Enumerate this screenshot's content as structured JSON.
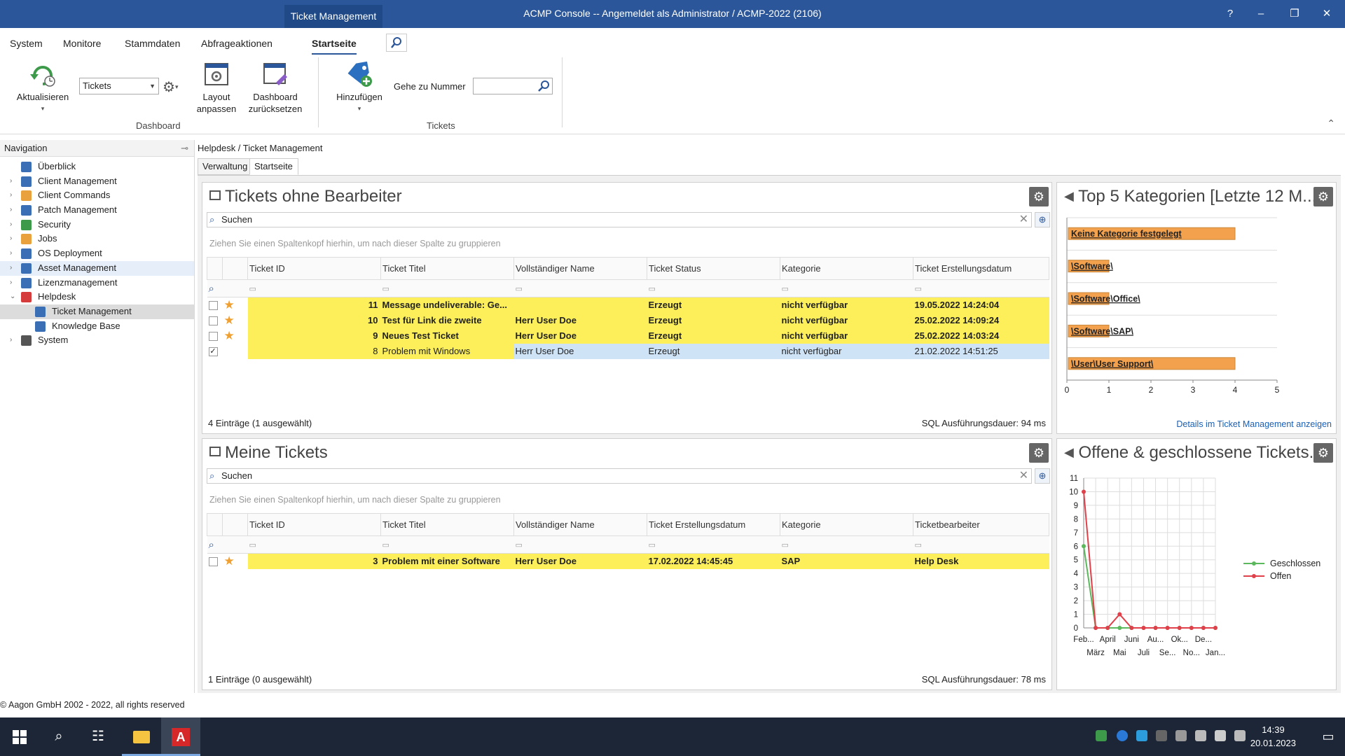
{
  "window": {
    "context_tab": "Ticket Management",
    "title": "ACMP Console -- Angemeldet als Administrator / ACMP-2022 (2106)",
    "help": "?",
    "minimize": "–",
    "restore": "❐",
    "close": "✕"
  },
  "menu": {
    "tabs": [
      "System",
      "Monitore",
      "Stammdaten",
      "Abfrageaktionen",
      "Startseite"
    ],
    "active_tab": "Startseite"
  },
  "ribbon": {
    "refresh_label": "Aktualisieren",
    "dashboard_combo": "Tickets",
    "layout_label": "Layout anpassen",
    "reset_label": "Dashboard zurücksetzen",
    "group_dashboard": "Dashboard",
    "add_label": "Hinzufügen",
    "goto_label": "Gehe zu Nummer",
    "goto_value": "",
    "group_tickets": "Tickets",
    "collapse": "⌃"
  },
  "navigation": {
    "header": "Navigation",
    "items": [
      {
        "label": "Überblick",
        "indent": 0,
        "expandable": false,
        "color": "#3a6fb5"
      },
      {
        "label": "Client Management",
        "indent": 0,
        "expandable": true,
        "color": "#3a6fb5"
      },
      {
        "label": "Client Commands",
        "indent": 0,
        "expandable": true,
        "color": "#e8a13c"
      },
      {
        "label": "Patch Management",
        "indent": 0,
        "expandable": true,
        "color": "#3a6fb5"
      },
      {
        "label": "Security",
        "indent": 0,
        "expandable": true,
        "color": "#3d9a4a"
      },
      {
        "label": "Jobs",
        "indent": 0,
        "expandable": true,
        "color": "#e8a13c"
      },
      {
        "label": "OS Deployment",
        "indent": 0,
        "expandable": true,
        "color": "#3a6fb5"
      },
      {
        "label": "Asset Management",
        "indent": 0,
        "expandable": true,
        "color": "#3a6fb5"
      },
      {
        "label": "Lizenzmanagement",
        "indent": 0,
        "expandable": true,
        "color": "#3a6fb5"
      },
      {
        "label": "Helpdesk",
        "indent": 0,
        "expandable": true,
        "expanded": true,
        "color": "#d63b3b"
      },
      {
        "label": "Ticket Management",
        "indent": 1,
        "expandable": false,
        "color": "#3a6fb5"
      },
      {
        "label": "Knowledge Base",
        "indent": 1,
        "expandable": false,
        "color": "#3a6fb5"
      },
      {
        "label": "System",
        "indent": 0,
        "expandable": true,
        "color": "#555555"
      }
    ]
  },
  "breadcrumb": "Helpdesk / Ticket Management",
  "subtabs": [
    "Verwaltung",
    "Startseite"
  ],
  "panel1": {
    "title": "Tickets ohne Bearbeiter",
    "search_placeholder": "Suchen",
    "group_hint": "Ziehen Sie einen Spaltenkopf hierhin, um nach dieser Spalte zu gruppieren",
    "columns": [
      "Ticket ID",
      "Ticket Titel",
      "Vollständiger Name",
      "Ticket Status",
      "Kategorie",
      "Ticket Erstellungsdatum"
    ],
    "rows": [
      {
        "checked": false,
        "star": true,
        "id": "11",
        "title": "Message undeliverable: Ge...",
        "name": "",
        "status": "Erzeugt",
        "category": "nicht verfügbar",
        "date": "19.05.2022 14:24:04"
      },
      {
        "checked": false,
        "star": true,
        "id": "10",
        "title": "Test für Link die zweite",
        "name": "Herr User Doe",
        "status": "Erzeugt",
        "category": "nicht verfügbar",
        "date": "25.02.2022 14:09:24"
      },
      {
        "checked": false,
        "star": true,
        "id": "9",
        "title": "Neues Test Ticket",
        "name": "Herr User Doe",
        "status": "Erzeugt",
        "category": "nicht verfügbar",
        "date": "25.02.2022 14:03:24"
      },
      {
        "checked": true,
        "star": false,
        "id": "8",
        "title": "Problem mit Windows",
        "name": "Herr User Doe",
        "status": "Erzeugt",
        "category": "nicht verfügbar",
        "date": "21.02.2022 14:51:25"
      }
    ],
    "footer_left": "4 Einträge (1 ausgewählt)",
    "footer_right": "SQL Ausführungsdauer: 94 ms"
  },
  "panel2": {
    "title": "Meine Tickets",
    "search_placeholder": "Suchen",
    "group_hint": "Ziehen Sie einen Spaltenkopf hierhin, um nach dieser Spalte zu gruppieren",
    "columns": [
      "Ticket ID",
      "Ticket Titel",
      "Vollständiger Name",
      "Ticket Erstellungsdatum",
      "Kategorie",
      "Ticketbearbeiter"
    ],
    "rows": [
      {
        "checked": false,
        "star": true,
        "id": "3",
        "title": "Problem mit einer Software",
        "name": "Herr User Doe",
        "date": "17.02.2022 14:45:45",
        "category": "SAP",
        "agent": "Help Desk"
      }
    ],
    "footer_left": "1 Einträge (0 ausgewählt)",
    "footer_right": "SQL Ausführungsdauer: 78 ms"
  },
  "panel3": {
    "title": "Top 5 Kategorien [Letzte 12 M...",
    "link": "Details im Ticket Management anzeigen"
  },
  "panel4": {
    "title": "Offene & geschlossene Tickets..."
  },
  "chart_data": [
    {
      "type": "bar",
      "orientation": "horizontal",
      "categories": [
        "Keine Kategorie festgelegt",
        "\\Software\\",
        "\\Software\\Office\\",
        "\\Software\\SAP\\",
        "\\User\\User Support\\"
      ],
      "values": [
        4,
        1,
        1,
        1,
        4
      ],
      "xlim": [
        0,
        5
      ],
      "x_ticks": [
        "0",
        "1",
        "2",
        "3",
        "4",
        "5"
      ],
      "bar_color": "#f3a14d",
      "grid": true
    },
    {
      "type": "line",
      "x": [
        "Feb...",
        "März",
        "April",
        "Mai",
        "Juni",
        "Juli",
        "Au...",
        "Se...",
        "Ok...",
        "No...",
        "De...",
        "Jan..."
      ],
      "series": [
        {
          "name": "Geschlossen",
          "color": "#5cb85c",
          "values": [
            6,
            0,
            0,
            0,
            0,
            0,
            0,
            0,
            0,
            0,
            0,
            0
          ]
        },
        {
          "name": "Offen",
          "color": "#e0404a",
          "values": [
            10,
            0,
            0,
            1,
            0,
            0,
            0,
            0,
            0,
            0,
            0,
            0
          ]
        }
      ],
      "ylim": [
        0,
        11
      ],
      "y_ticks": [
        "0",
        "1",
        "2",
        "3",
        "4",
        "5",
        "6",
        "7",
        "8",
        "9",
        "10",
        "11"
      ],
      "legend": "right",
      "grid": true
    }
  ],
  "footer": "© Aagon GmbH 2002 - 2022, all rights reserved",
  "taskbar": {
    "time": "14:39",
    "date": "20.01.2023"
  }
}
